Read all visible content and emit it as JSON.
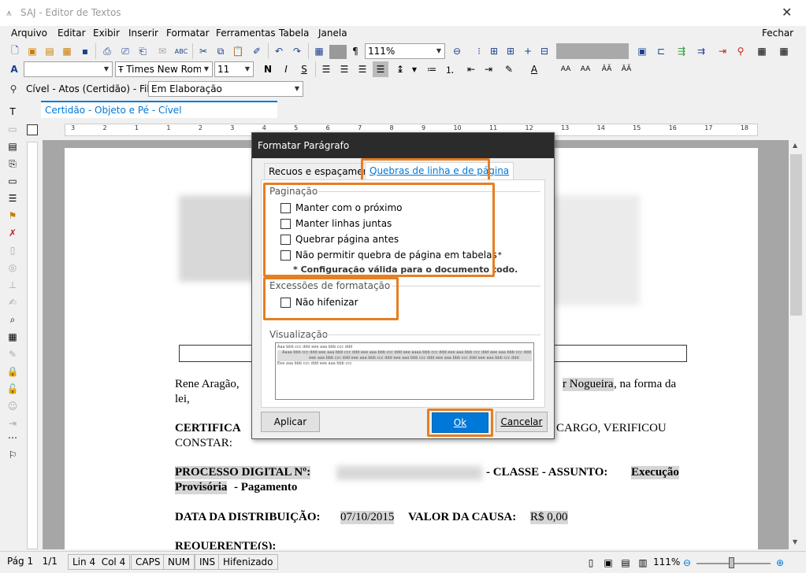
{
  "window": {
    "title": "SAJ - Editor de Textos"
  },
  "menu": {
    "items": [
      "Arquivo",
      "Editar",
      "Exibir",
      "Inserir",
      "Formatar",
      "Ferramentas",
      "Tabela",
      "Janela"
    ],
    "close_label": "Fechar"
  },
  "toolbar": {
    "zoom": "111%",
    "font_name": "Times New Roman",
    "font_size": "11"
  },
  "queue": {
    "label": "Cível - Atos (Certidão) - Fila:",
    "value": "Em Elaboração"
  },
  "doc_tab": {
    "label": "Certidão - Objeto e Pé - Cível"
  },
  "ruler": {
    "ticks": [
      "3",
      "2",
      "1",
      "1",
      "2",
      "3",
      "4",
      "5",
      "6",
      "7",
      "8",
      "9",
      "10",
      "11",
      "12",
      "13",
      "14",
      "15",
      "16",
      "17",
      "18"
    ]
  },
  "document": {
    "line1_start": "Rene Aragão,",
    "line1_end_hl": "r Nogueira",
    "line1_end": ", na forma da",
    "line2": "lei,",
    "certifica": "CERTIFICA",
    "certifica_end": "CARGO, VERIFICOU",
    "constar": "CONSTAR:",
    "processo_label": "PROCESSO DIGITAL Nº:",
    "classe": "- CLASSE - ASSUNTO:",
    "classe_value": "Execução",
    "provisoria": "Provisória",
    "pagamento": "- Pagamento",
    "data_label": "DATA DA DISTRIBUIÇÃO:",
    "data_value": "07/10/2015",
    "valor_label": "VALOR DA CAUSA:",
    "valor_value": "R$ 0,00",
    "requerente": "REQUERENTE(S):"
  },
  "dialog": {
    "title": "Formatar Parágrafo",
    "tabs": [
      "Recuos e espaçamento",
      "Quebras de linha e de página"
    ],
    "pagination_group": "Paginação",
    "options": [
      "Manter com o próximo",
      "Manter linhas juntas",
      "Quebrar página antes",
      "Não permitir quebra de página em tabelas"
    ],
    "option_mark": "*",
    "note": "* Configuração válida para o documento todo.",
    "exceptions_group": "Excessões de formatação",
    "no_hyphen": "Não hifenizar",
    "preview_group": "Visualização",
    "preview_lines": [
      "Aaa bbb ccc ddd eee aaa bbb ccc ddd",
      "Aaaa bbb ccc ddd eee aaa bbb ccc ddd eee aaa bbb ccc ddd eee aaaa bbb ccc ddd eee aaa bbb ccc ddd eee aaa bbb ccc ddd",
      "eee aaa bbb ccc ddd eee aaa bbb ccc ddd eee aaa bbb ccc ddd eee aaa bbb ccc ddd eee aaa bbb ccc ddd",
      "Eee aaa bbb ccc ddd eee aaa bbb ccc"
    ],
    "apply": "Aplicar",
    "ok": "Ok",
    "cancel": "Cancelar"
  },
  "status": {
    "page": "Pág 1",
    "pages": "1/1",
    "pos": "Lin 4  Col 4",
    "caps": "CAPS",
    "num": "NUM",
    "ins": "INS",
    "hyphen": "Hifenizado",
    "zoom": "111%"
  },
  "colors": {
    "accent": "#e67e22",
    "primary": "#0078d7",
    "dialog_title": "#2b2b2b"
  }
}
